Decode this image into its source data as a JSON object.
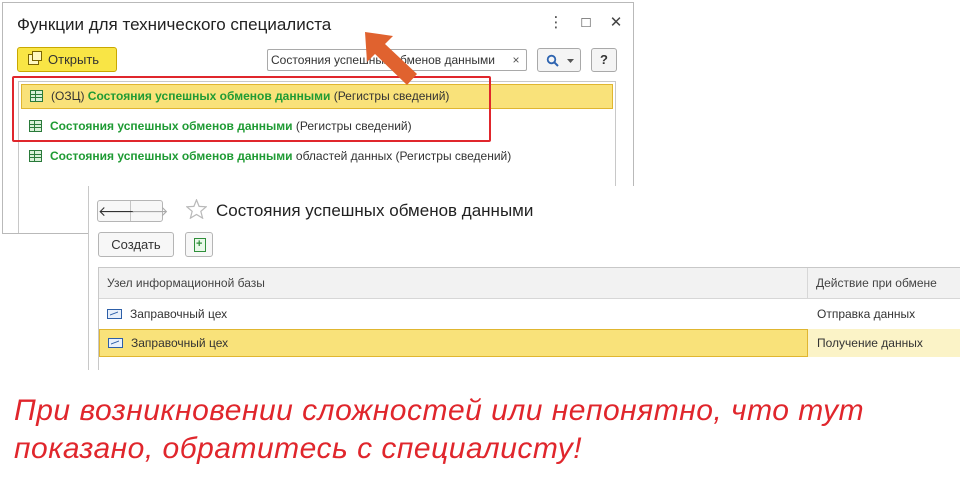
{
  "window1": {
    "title": "Функции для технического специалиста",
    "controls": {
      "more": "⋮",
      "maximize": "□",
      "close": "✕"
    },
    "toolbar": {
      "open_label": "Открыть",
      "search_value": "Состояния успешных обменов данными",
      "search_clear": "×",
      "search_icon": "search-icon",
      "help_label": "?"
    },
    "results": [
      {
        "prefix": "(ОЗЦ) ",
        "highlight": "Состояния успешных обменов данными",
        "suffix": " (Регистры сведений)",
        "selected": true
      },
      {
        "prefix": "",
        "highlight": "Состояния успешных обменов данными",
        "suffix": " (Регистры сведений)",
        "selected": false
      },
      {
        "prefix": "",
        "highlight": "Состояния успешных обменов данными",
        "suffix": " областей данных (Регистры сведений)",
        "selected": false
      }
    ]
  },
  "window2": {
    "nav": {
      "back": "🡐",
      "forward": "🡒"
    },
    "favorite_icon": "star-icon",
    "title": "Состояния успешных обменов данными",
    "toolbar": {
      "create_label": "Создать",
      "copy_icon": "copy-icon"
    },
    "table": {
      "columns": [
        "Узел информационной базы",
        "Действие при обмене"
      ],
      "rows": [
        {
          "node": "Заправочный цех",
          "action": "Отправка данных",
          "selected": false
        },
        {
          "node": "Заправочный цех",
          "action": "Получение данных",
          "selected": true
        }
      ]
    }
  },
  "annotation": {
    "note": "При возникновении сложностей или непонятно, что тут показано, обратитесь с специалисту!",
    "accent_color": "#e0262c",
    "arrow_color": "#e0622f"
  }
}
